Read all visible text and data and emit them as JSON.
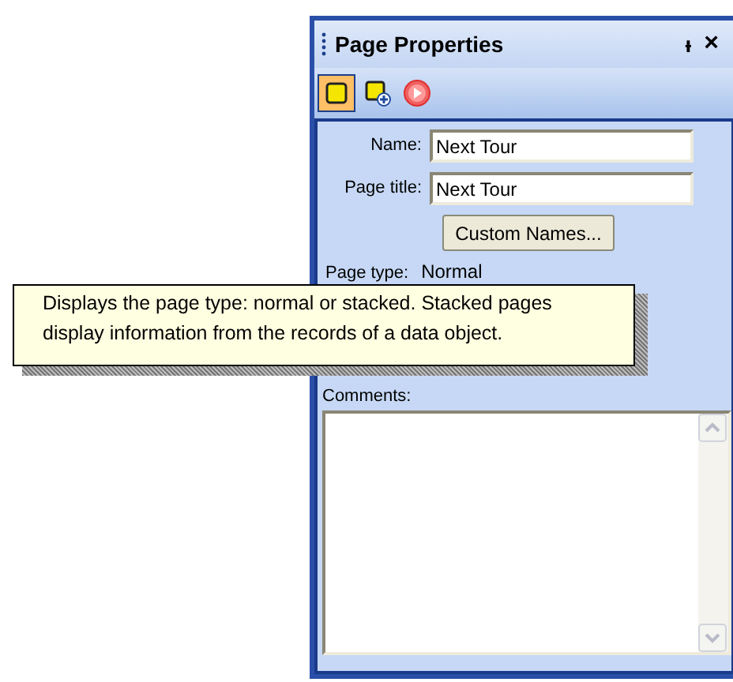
{
  "panel": {
    "title": "Page Properties",
    "pin": "ᵼ",
    "close": "×"
  },
  "toolbar": [
    {
      "kind": "page",
      "selected": true
    },
    {
      "kind": "add-page",
      "selected": false
    },
    {
      "kind": "play",
      "selected": false
    }
  ],
  "fields": [
    {
      "label": "Name:",
      "value": "Next Tour"
    },
    {
      "label": "Page title:",
      "value": "Next Tour"
    }
  ],
  "custom_names_button": "Custom Names...",
  "page_type": {
    "label": "Page type:",
    "value": "Normal"
  },
  "comments": {
    "label": "Comments:"
  },
  "tooltip": "Displays the page type: normal or stacked. Stacked pages display information from the records of a data object."
}
